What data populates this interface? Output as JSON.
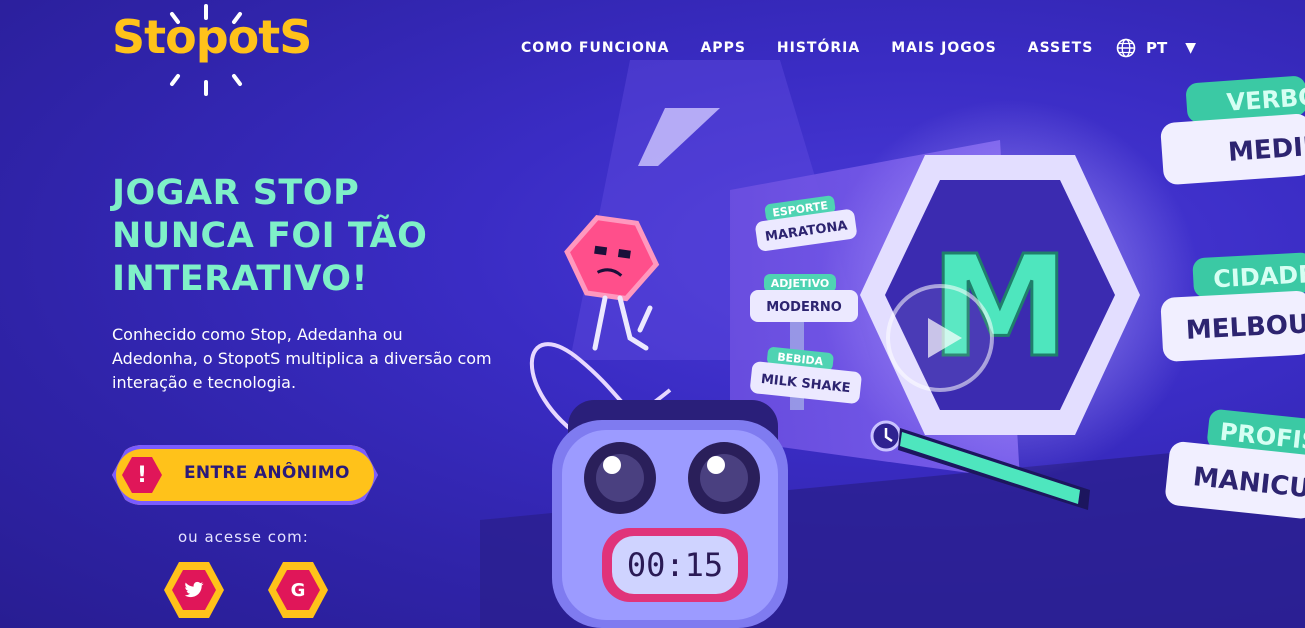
{
  "brand": {
    "logo_text": "StopotS",
    "color": "#ffc21a"
  },
  "nav": {
    "items": [
      "COMO FUNCIONA",
      "APPS",
      "HISTÓRIA",
      "MAIS JOGOS",
      "ASSETS"
    ],
    "language": "PT",
    "language_caret": "▼"
  },
  "hero": {
    "headline": "JOGAR STOP NUNCA FOI TÃO INTERATIVO!",
    "description": "Conhecido como Stop, Adedanha ou Adedonha, o StopotS multiplica a diversão com interação e tecnologia.",
    "cta_label": "ENTRE ANÔNIMO",
    "cta_badge": "!",
    "or_text": "ou acesse com:"
  },
  "scene": {
    "letter": "M",
    "timer": "00:15",
    "small_tags": [
      {
        "category": "ESPORTE",
        "value": "MARATONA"
      },
      {
        "category": "ADJETIVO",
        "value": "MODERNO"
      },
      {
        "category": "BEBIDA",
        "value": "MILK SHAKE"
      }
    ],
    "big_tags": [
      {
        "category": "VERBO",
        "value": "MEDIR"
      },
      {
        "category": "CIDADE",
        "value": "MELBOURNE"
      },
      {
        "category": "PROFISSÃO",
        "value": "MANICURE"
      }
    ],
    "timer_progress": 0.85
  },
  "colors": {
    "accent_yellow": "#ffc21a",
    "accent_mint": "#7ff0c8",
    "accent_pink": "#e01659",
    "background": "#3a2cc4"
  }
}
